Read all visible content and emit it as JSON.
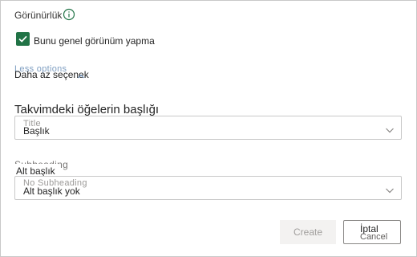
{
  "visibility": {
    "label": "Görünürlük",
    "checkbox_label": "Bunu genel görünüm yapma",
    "checked": true
  },
  "options": {
    "ghost_label": "Less options",
    "fewer_label": "Daha az seçenek"
  },
  "title_field": {
    "label": "Takvimdeki öğelerin başlığı",
    "ghost_value": "Title",
    "value": "Başlık"
  },
  "subheading_field": {
    "ghost_label": "Subheading",
    "label": "Alt başlık",
    "ghost_value": "No Subheading",
    "value": "Alt başlık yok"
  },
  "actions": {
    "create_label": "Create",
    "cancel_ghost": "Cancel",
    "cancel_label": "İptal"
  },
  "colors": {
    "accent": "#217346",
    "info": "#217346"
  }
}
